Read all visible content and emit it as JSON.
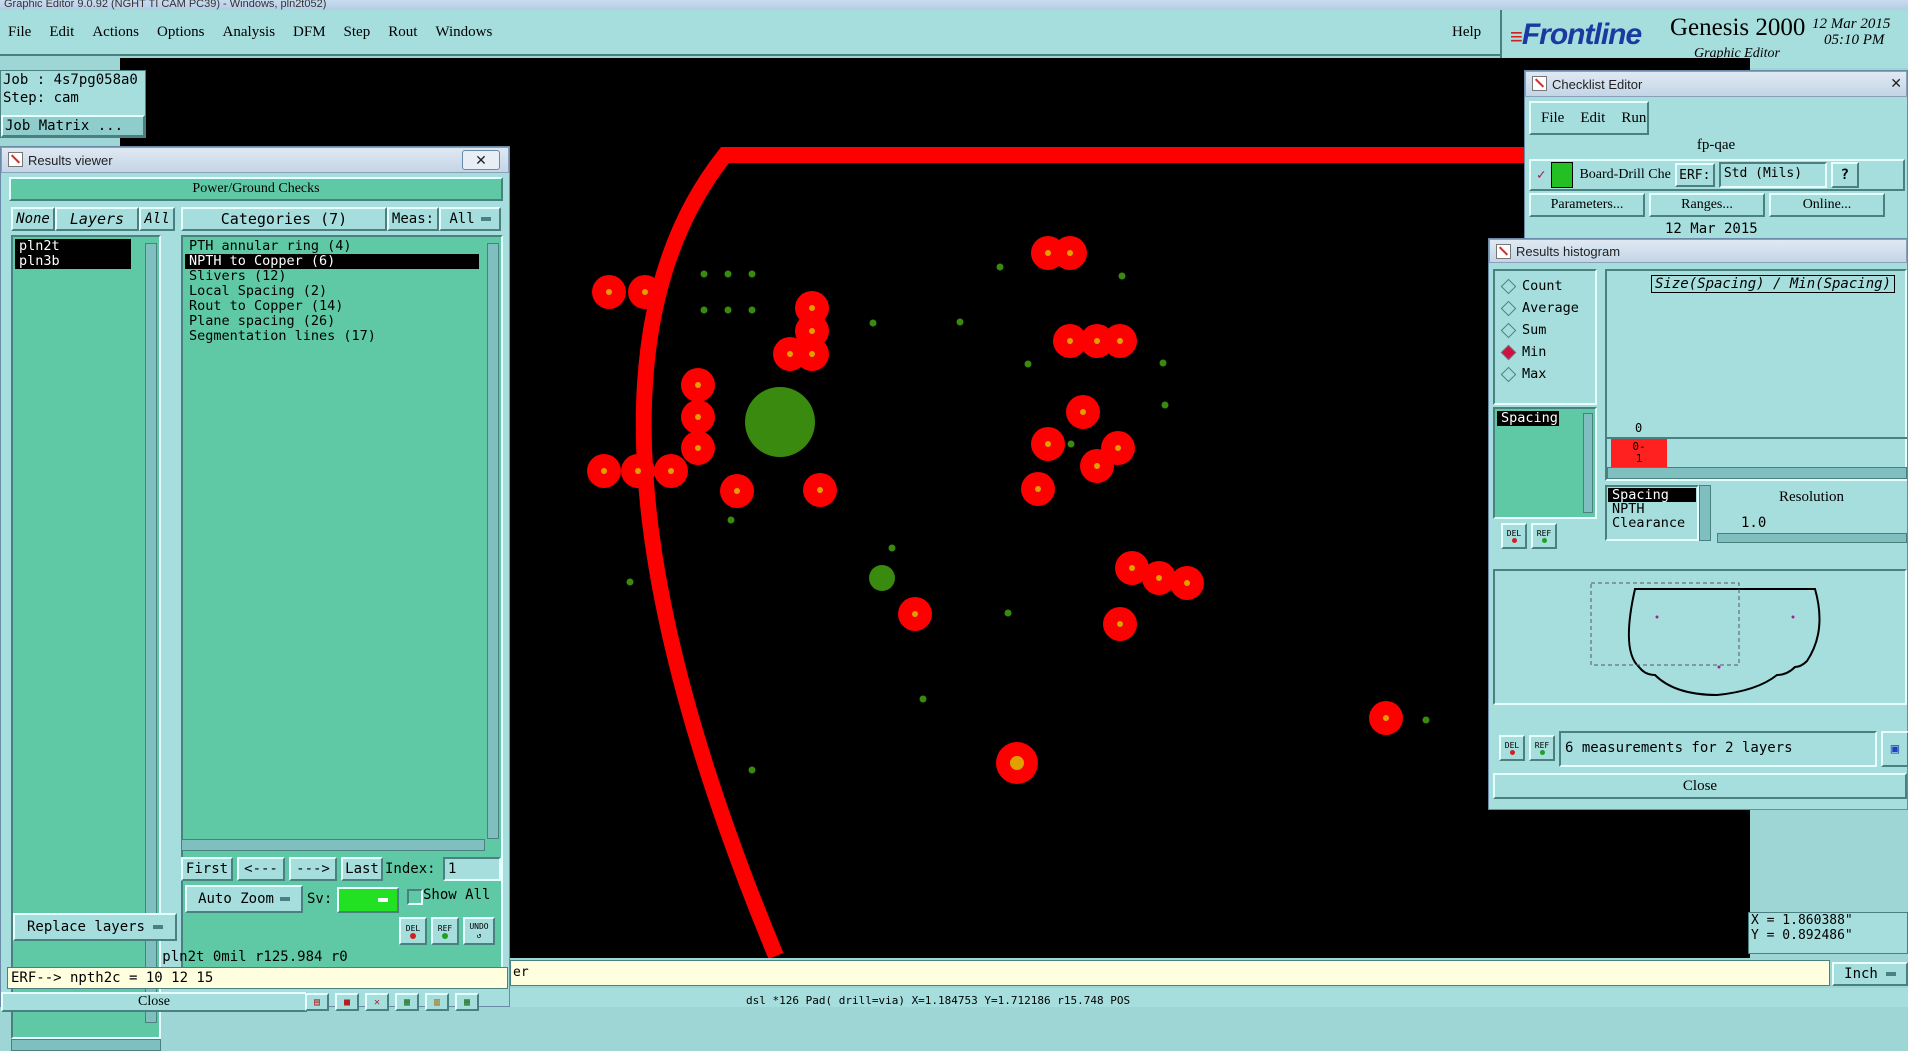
{
  "os_title": "Graphic Editor 9.0.92 (NGHT TI CAM PC39) - Windows, pln2t052)",
  "menu": [
    "File",
    "Edit",
    "Actions",
    "Options",
    "Analysis",
    "DFM",
    "Step",
    "Rout",
    "Windows"
  ],
  "help": "Help",
  "brand": {
    "logo": "Frontline",
    "product": "Genesis 2000",
    "subtitle": "Graphic Editor",
    "date": "12 Mar 2015",
    "time": "05:10 PM"
  },
  "job": {
    "job": "Job : 4s7pg058a0",
    "step": "Step: cam",
    "matrix": "Job Matrix ..."
  },
  "results_viewer": {
    "title": "Results viewer",
    "header": "Power/Ground Checks",
    "none": "None",
    "layers": "Layers",
    "all": "All",
    "categories": "Categories (7)",
    "meas_label": "Meas:",
    "meas_value": "All",
    "layer_list": [
      "pln2t",
      "pln3b"
    ],
    "category_list": [
      "PTH annular ring (4)",
      "NPTH to Copper (6)",
      "Slivers (12)",
      "Local Spacing (2)",
      "Rout to Copper (14)",
      "Plane spacing (26)",
      "Segmentation lines (17)"
    ],
    "selected_category": 1,
    "nav": {
      "first": "First",
      "prev": "<---",
      "next": "--->",
      "last": "Last",
      "index_label": "Index:",
      "index_value": "1"
    },
    "auto_zoom": "Auto Zoom",
    "sv": "Sv:",
    "show_all": "Show All",
    "del": "DEL",
    "ref": "REF",
    "undo": "UNDO",
    "replace_layers": "Replace layers",
    "status": "pln2t 0mil  r125.984  r0",
    "erf": "ERF--> npth2c = 10 12 15",
    "close": "Close"
  },
  "checklist": {
    "title": "Checklist Editor",
    "menu": [
      "File",
      "Edit",
      "Run"
    ],
    "name": "fp-qae",
    "row_label": "Board-Drill Che",
    "erf": "ERF:",
    "std": "Std (Mils)",
    "help": "?",
    "params": "Parameters...",
    "ranges": "Ranges...",
    "online": "Online...",
    "date": "12 Mar 2015"
  },
  "histogram": {
    "title": "Results histogram",
    "modes": [
      "Count",
      "Average",
      "Sum",
      "Min",
      "Max"
    ],
    "selected_mode": "Min",
    "list": [
      "Spacing"
    ],
    "size_label": "Size(Spacing) / Min(Spacing)",
    "axis_zero": "0",
    "bin_label": "0-\n1",
    "types": [
      "Spacing",
      "NPTH",
      "Clearance"
    ],
    "resolution_label": "Resolution",
    "resolution_value": "1.0",
    "del": "DEL",
    "ref": "REF",
    "measurements": "6 measurements for 2 layers",
    "close": "Close"
  },
  "coords": {
    "x": "X = 1.860388\"",
    "y": "Y = 0.892486\""
  },
  "units": "Inch",
  "cmd_tail": "er",
  "bottom_status": "dsl *126 Pad( drill=via) X=1.184753 Y=1.712186 r15.748 POS",
  "colors": {
    "pad": "#ff0000",
    "center": "#e0a000",
    "via": "#3a8a10",
    "outline": "#ff0000"
  }
}
